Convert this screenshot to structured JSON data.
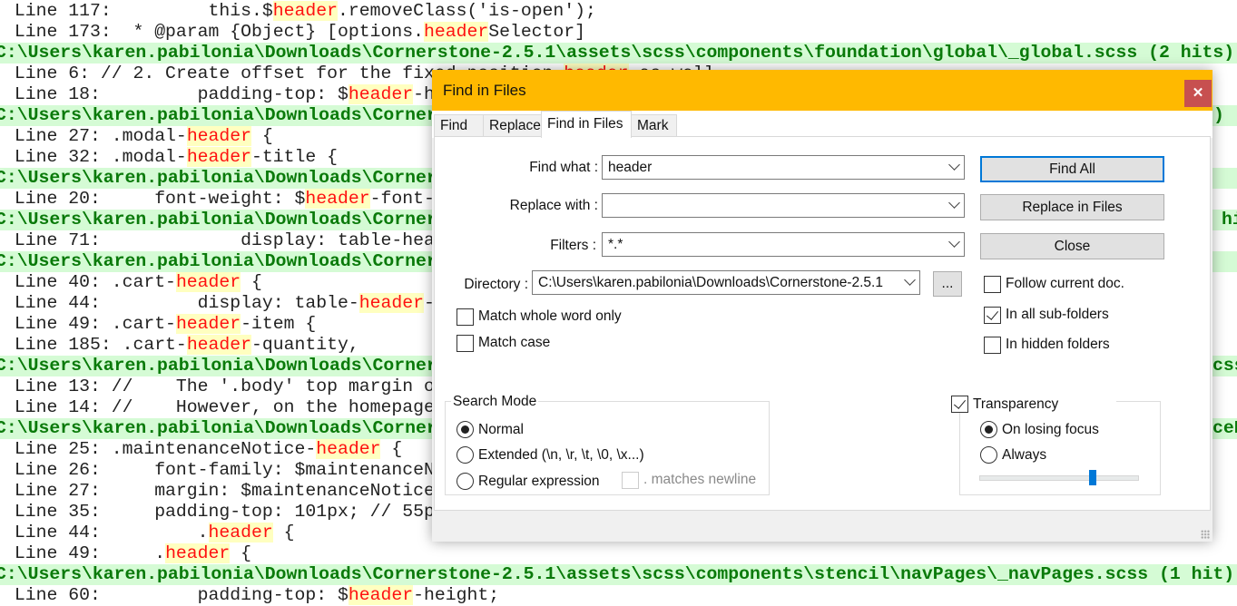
{
  "results": {
    "rows": [
      {
        "type": "line",
        "text": " Line 117:         this.$header.removeClass('is-open');"
      },
      {
        "type": "line",
        "text": " Line 173:  * @param {Object} [options.headerSelector]"
      },
      {
        "type": "path",
        "text": "C:\\Users\\karen.pabilonia\\Downloads\\Cornerstone-2.5.1\\assets\\scss\\components\\foundation\\global\\_global.scss (2 hits)"
      },
      {
        "type": "line",
        "text": " Line 6: // 2. Create offset for the fixed position header as well."
      },
      {
        "type": "line",
        "text": " Line 18:         padding-top: $header-h"
      },
      {
        "type": "path",
        "text": "C:\\Users\\karen.pabilonia\\Downloads\\Corner",
        "frag": ")"
      },
      {
        "type": "line",
        "text": " Line 27: .modal-header {"
      },
      {
        "type": "line",
        "text": " Line 32: .modal-header-title {"
      },
      {
        "type": "path",
        "text": "C:\\Users\\karen.pabilonia\\Downloads\\Corner"
      },
      {
        "type": "line",
        "text": " Line 20:     font-weight: $header-font-"
      },
      {
        "type": "path",
        "text": "C:\\Users\\karen.pabilonia\\Downloads\\Corner",
        "frag": "hi"
      },
      {
        "type": "line",
        "text": " Line 71:             display: table-hea"
      },
      {
        "type": "path",
        "text": "C:\\Users\\karen.pabilonia\\Downloads\\Corner"
      },
      {
        "type": "line",
        "text": " Line 40: .cart-header {"
      },
      {
        "type": "line",
        "text": " Line 44:         display: table-header-"
      },
      {
        "type": "line",
        "text": " Line 49: .cart-header-item {"
      },
      {
        "type": "line",
        "text": " Line 185: .cart-header-quantity,"
      },
      {
        "type": "path",
        "text": "C:\\Users\\karen.pabilonia\\Downloads\\Corner",
        "frag": "css"
      },
      {
        "type": "line",
        "text": " Line 13: //    The '.body' top margin o"
      },
      {
        "type": "line",
        "text": " Line 14: //    However, on the homepage"
      },
      {
        "type": "path",
        "text": "C:\\Users\\karen.pabilonia\\Downloads\\Corner",
        "frag": "ceN"
      },
      {
        "type": "line",
        "text": " Line 25: .maintenanceNotice-header {"
      },
      {
        "type": "line",
        "text": " Line 26:     font-family: $maintenanceN"
      },
      {
        "type": "line",
        "text": " Line 27:     margin: $maintenanceNotice"
      },
      {
        "type": "line",
        "text": " Line 35:     padding-top: 101px; // 55p"
      },
      {
        "type": "line",
        "text": " Line 44:         .header {"
      },
      {
        "type": "line",
        "text": " Line 49:     .header {"
      },
      {
        "type": "path",
        "text": "C:\\Users\\karen.pabilonia\\Downloads\\Cornerstone-2.5.1\\assets\\scss\\components\\stencil\\navPages\\_navPages.scss (1 hit)"
      },
      {
        "type": "line",
        "text": " Line 60:         padding-top: $header-height;"
      }
    ],
    "search_term": "header",
    "colors": {
      "path_bg": "#d5fbd5",
      "path_text": "#0a7a0a",
      "match_bg": "#ffffc0",
      "match_text": "#ff1010"
    }
  },
  "dialog": {
    "title": "Find in Files",
    "close_icon": "close-icon",
    "colors": {
      "titlebar": "#ffb900",
      "close": "#c75050",
      "focus": "#0078d7"
    },
    "tabs": [
      {
        "label": "Find",
        "active": false
      },
      {
        "label": "Replace",
        "active": false
      },
      {
        "label": "Find in Files",
        "active": true
      },
      {
        "label": "Mark",
        "active": false
      }
    ],
    "find_what": {
      "label": "Find what :",
      "value": "header"
    },
    "replace_with": {
      "label": "Replace with :",
      "value": ""
    },
    "filters": {
      "label": "Filters :",
      "value": "*.*"
    },
    "directory": {
      "label": "Directory :",
      "value": "C:\\Users\\karen.pabilonia\\Downloads\\Cornerstone-2.5.1",
      "browse_label": "..."
    },
    "buttons": {
      "find_all": "Find All",
      "replace_in_files": "Replace in Files",
      "close": "Close"
    },
    "options": {
      "follow_current_doc": {
        "label": "Follow current doc.",
        "checked": false
      },
      "in_all_subfolders": {
        "label": "In all sub-folders",
        "checked": true
      },
      "in_hidden_folders": {
        "label": "In hidden folders",
        "checked": false
      },
      "match_whole_word": {
        "label": "Match whole word only",
        "checked": false
      },
      "match_case": {
        "label": "Match case",
        "checked": false
      }
    },
    "search_mode": {
      "label": "Search Mode",
      "normal": "Normal",
      "extended": "Extended (\\n, \\r, \\t, \\0, \\x...)",
      "regex": "Regular expression",
      "matches_newline": ". matches newline",
      "selected": "Normal"
    },
    "transparency": {
      "label": "Transparency",
      "enabled": true,
      "on_losing_focus": "On losing focus",
      "always": "Always",
      "selected": "On losing focus",
      "level": 0.71
    }
  }
}
